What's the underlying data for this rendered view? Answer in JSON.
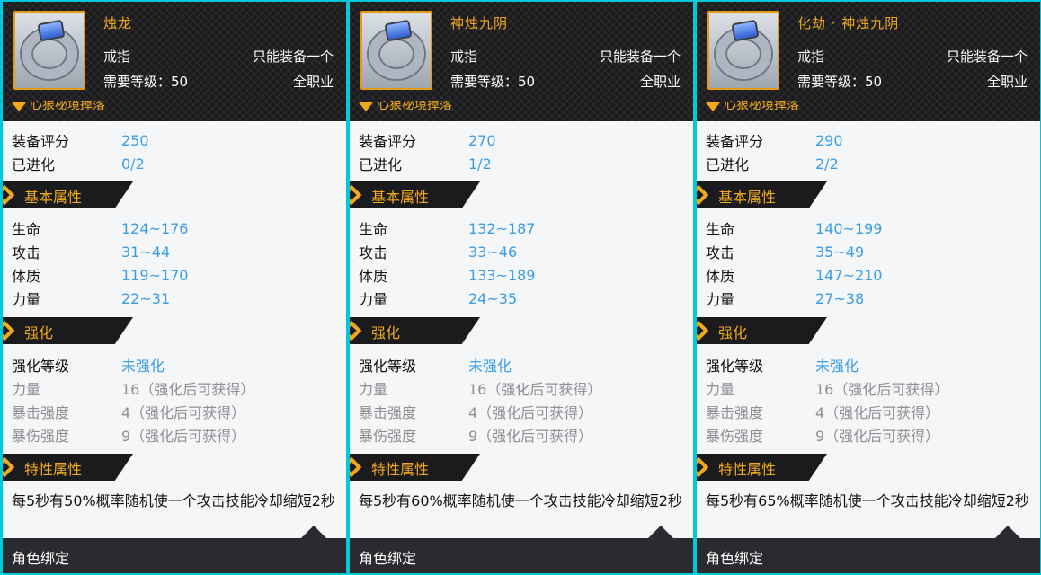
{
  "panels": [
    {
      "name": "烛龙",
      "type": "戒指",
      "unique": "只能装备一个",
      "level": "需要等级：50",
      "class": "全职业",
      "source": "心狠秘境掉落",
      "score_label": "装备评分",
      "score": "250",
      "evolve_label": "已进化",
      "evolve": "0/2",
      "sec_basic": "基本属性",
      "basic": [
        {
          "k": "生命",
          "v": "124~176"
        },
        {
          "k": "攻击",
          "v": "31~44"
        },
        {
          "k": "体质",
          "v": "119~170"
        },
        {
          "k": "力量",
          "v": "22~31"
        }
      ],
      "sec_enh": "强化",
      "enh_level_label": "强化等级",
      "enh_level": "未强化",
      "enh": [
        {
          "k": "力量",
          "v": "16（强化后可获得）"
        },
        {
          "k": "暴击强度",
          "v": "4（强化后可获得）"
        },
        {
          "k": "暴伤强度",
          "v": "9（强化后可获得）"
        }
      ],
      "sec_trait": "特性属性",
      "trait": "每5秒有50%概率随机使一个攻击技能冷却缩短2秒",
      "footer": "角色绑定"
    },
    {
      "name": "神烛九阴",
      "type": "戒指",
      "unique": "只能装备一个",
      "level": "需要等级：50",
      "class": "全职业",
      "source": "心狠秘境掉落",
      "score_label": "装备评分",
      "score": "270",
      "evolve_label": "已进化",
      "evolve": "1/2",
      "sec_basic": "基本属性",
      "basic": [
        {
          "k": "生命",
          "v": "132~187"
        },
        {
          "k": "攻击",
          "v": "33~46"
        },
        {
          "k": "体质",
          "v": "133~189"
        },
        {
          "k": "力量",
          "v": "24~35"
        }
      ],
      "sec_enh": "强化",
      "enh_level_label": "强化等级",
      "enh_level": "未强化",
      "enh": [
        {
          "k": "力量",
          "v": "16（强化后可获得）"
        },
        {
          "k": "暴击强度",
          "v": "4（强化后可获得）"
        },
        {
          "k": "暴伤强度",
          "v": "9（强化后可获得）"
        }
      ],
      "sec_trait": "特性属性",
      "trait": "每5秒有60%概率随机使一个攻击技能冷却缩短2秒",
      "footer": "角色绑定"
    },
    {
      "name": "化劫 · 神烛九阴",
      "type": "戒指",
      "unique": "只能装备一个",
      "level": "需要等级：50",
      "class": "全职业",
      "source": "心狠秘境掉落",
      "score_label": "装备评分",
      "score": "290",
      "evolve_label": "已进化",
      "evolve": "2/2",
      "sec_basic": "基本属性",
      "basic": [
        {
          "k": "生命",
          "v": "140~199"
        },
        {
          "k": "攻击",
          "v": "35~49"
        },
        {
          "k": "体质",
          "v": "147~210"
        },
        {
          "k": "力量",
          "v": "27~38"
        }
      ],
      "sec_enh": "强化",
      "enh_level_label": "强化等级",
      "enh_level": "未强化",
      "enh": [
        {
          "k": "力量",
          "v": "16（强化后可获得）"
        },
        {
          "k": "暴击强度",
          "v": "4（强化后可获得）"
        },
        {
          "k": "暴伤强度",
          "v": "9（强化后可获得）"
        }
      ],
      "sec_trait": "特性属性",
      "trait": "每5秒有65%概率随机使一个攻击技能冷却缩短2秒",
      "footer": "角色绑定"
    }
  ],
  "colors": {
    "accent": "#f0a91d",
    "value": "#3b9de6",
    "dark": "#1b1b1e",
    "frame": "#00c8d8"
  },
  "icons": {
    "item": "ring-icon",
    "source": "heart-icon"
  }
}
